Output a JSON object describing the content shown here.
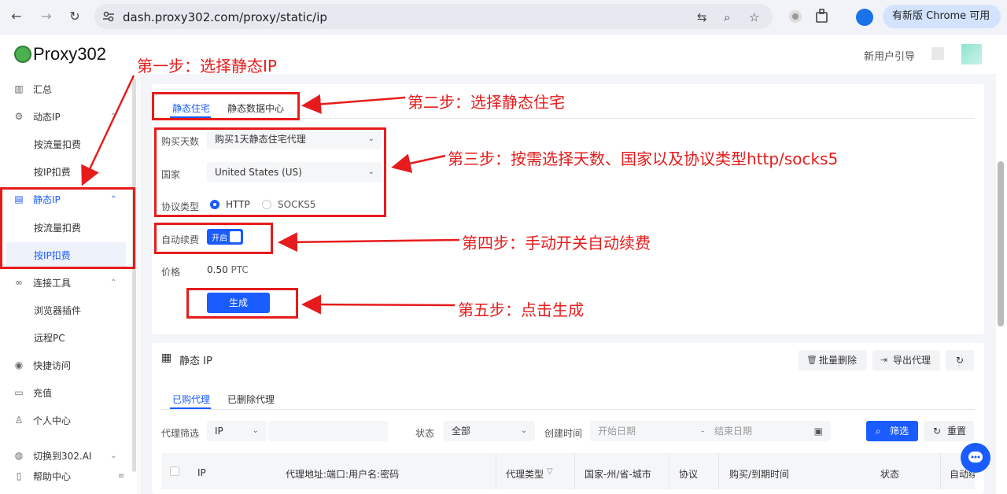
{
  "browser": {
    "url": "dash.proxy302.com/proxy/static/ip",
    "update_button": "有新版 Chrome 可用"
  },
  "header": {
    "logo_text": "Proxy302",
    "guide_link": "新用户引导"
  },
  "sidebar": {
    "items": [
      {
        "label": "汇总"
      },
      {
        "label": "动态IP"
      },
      {
        "label": "按流量扣费"
      },
      {
        "label": "按IP扣费"
      },
      {
        "label": "静态IP"
      },
      {
        "label": "按流量扣费"
      },
      {
        "label": "按IP扣费"
      },
      {
        "label": "连接工具"
      },
      {
        "label": "浏览器插件"
      },
      {
        "label": "远程PC"
      },
      {
        "label": "快捷访问"
      },
      {
        "label": "充值"
      },
      {
        "label": "个人中心"
      },
      {
        "label": "切换到302.AI"
      },
      {
        "label": "帮助中心"
      }
    ]
  },
  "purchase": {
    "tabs": [
      "静态住宅",
      "静态数据中心"
    ],
    "days_label": "购买天数",
    "days_value": "购买1天静态住宅代理",
    "country_label": "国家",
    "country_value": "United States (US)",
    "protocol_label": "协议类型",
    "protocol_http": "HTTP",
    "protocol_socks": "SOCKS5",
    "auto_renew_label": "自动续费",
    "auto_renew_toggle": "开启",
    "price_label": "价格",
    "price_value": "0.50",
    "price_unit": "PTC",
    "generate_button": "生成"
  },
  "annotations": {
    "step1": "第一步：选择静态IP",
    "step2": "第二步：选择静态住宅",
    "step3": "第三步：按需选择天数、国家以及协议类型http/socks5",
    "step4": "第四步：手动开关自动续费",
    "step5": "第五步：点击生成"
  },
  "list": {
    "title": "静态 IP",
    "batch_delete": "批量删除",
    "export": "导出代理",
    "tabs": [
      "已购代理",
      "已删除代理"
    ],
    "filter_label": "代理筛选",
    "filter_type": "IP",
    "status_label": "状态",
    "status_value": "全部",
    "created_label": "创建时间",
    "start_date": "开始日期",
    "date_sep": "-",
    "end_date": "结束日期",
    "filter_button": "筛选",
    "reset_button": "重置",
    "columns": [
      "IP",
      "代理地址:端口:用户名:密码",
      "代理类型",
      "国家-州/省-城市",
      "协议",
      "购买/到期时间",
      "状态",
      "自动续"
    ]
  },
  "colors": {
    "accent": "#1a5cff",
    "annotation_red": "#e61c1c"
  }
}
